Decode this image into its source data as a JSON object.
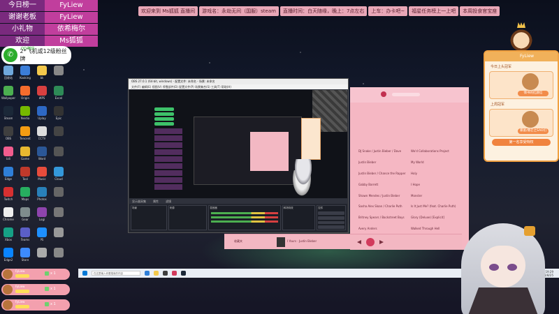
{
  "overlay_top_left": [
    {
      "key": "今日榜一",
      "value": "FyLiew"
    },
    {
      "key": "谢谢老板",
      "value": "FyLiew"
    },
    {
      "key": "小礼物",
      "value": "依希梅尔"
    },
    {
      "key": "欢迎",
      "value": "Ms狐狐"
    }
  ],
  "wechat": {
    "tag": "QQ/微信",
    "text": "2*飞机或12级粉丝牌"
  },
  "ticker": [
    "欢迎来到 Ms狐狐 直播间",
    "游戏名：永劫无间（国服）steam",
    "直播时间：白天随缘，晚上：7点左右",
    "上车：办卡吧~",
    "福星任务榜上一上吧",
    "本周投食官宝座"
  ],
  "desktop_icons": [
    {
      "label": "回收站",
      "color": "#6fa8dc"
    },
    {
      "label": "Kooking",
      "color": "#3b7dd8"
    },
    {
      "label": "bk",
      "color": "#f3c84b"
    },
    {
      "label": "",
      "color": "#888"
    },
    {
      "label": "Wallpaper",
      "color": "#4caf50"
    },
    {
      "label": "Origin",
      "color": "#f56c2d"
    },
    {
      "label": "WPS",
      "color": "#d94040"
    },
    {
      "label": "Excel",
      "color": "#2e8b57"
    },
    {
      "label": "Steam",
      "color": "#1b2838"
    },
    {
      "label": "Nvidia",
      "color": "#76b900"
    },
    {
      "label": "Uplay",
      "color": "#2d68c4"
    },
    {
      "label": "Epic",
      "color": "#333"
    },
    {
      "label": "OBS",
      "color": "#3f3f3f"
    },
    {
      "label": "Tencent",
      "color": "#f39c12"
    },
    {
      "label": "CCTV",
      "color": "#ddd"
    },
    {
      "label": "",
      "color": "#444"
    },
    {
      "label": "bili",
      "color": "#f25d8e"
    },
    {
      "label": "Game",
      "color": "#e8b830"
    },
    {
      "label": "Word",
      "color": "#2b5797"
    },
    {
      "label": "",
      "color": "#555"
    },
    {
      "label": "Edge",
      "color": "#2f7fd8"
    },
    {
      "label": "Tool",
      "color": "#c0392b"
    },
    {
      "label": "Music",
      "color": "#e74c3c"
    },
    {
      "label": "Cloud",
      "color": "#3498db"
    },
    {
      "label": "Twitch",
      "color": "#d63031"
    },
    {
      "label": "Maps",
      "color": "#27ae60"
    },
    {
      "label": "Photos",
      "color": "#2980b9"
    },
    {
      "label": "",
      "color": "#666"
    },
    {
      "label": "Chrome",
      "color": "#eee"
    },
    {
      "label": "Gear",
      "color": "#7f8c8d"
    },
    {
      "label": "Logi",
      "color": "#8e44ad"
    },
    {
      "label": "",
      "color": "#777"
    },
    {
      "label": "Xbox",
      "color": "#16a085"
    },
    {
      "label": "Teams",
      "color": "#5b5fc7"
    },
    {
      "label": "PS",
      "color": "#1e90ff"
    },
    {
      "label": "",
      "color": "#999"
    },
    {
      "label": "Edge2",
      "color": "#0a84ff"
    },
    {
      "label": "Store",
      "color": "#3d8bfd"
    },
    {
      "label": "",
      "color": "#aaa"
    },
    {
      "label": "",
      "color": "#888"
    }
  ],
  "obs": {
    "title": "OBS 27.0.1 (64-bit, windows) - 配置文件: 未命名 - 场景: 未命名",
    "menu": "文件(F)  编辑(E)  视图(V)  停靠部件(D)  配置文件(P)  场景集合(S)  工具(T)  帮助(H)",
    "toolbar": [
      "显示器采集",
      "属性",
      "滤镜"
    ],
    "docks": {
      "scenes": "场景",
      "sources": "来源",
      "mixer": "混音器",
      "transitions": "转场特效",
      "controls": "控件"
    },
    "controls": [
      "开始推流",
      "开始录制",
      "工作室模式",
      "设置",
      "退出"
    ]
  },
  "music": {
    "list": [
      {
        "artist": "DJ Snake / Justin Bieber / Dave",
        "song": "Wo'd Collaborations Project"
      },
      {
        "artist": "Justin Bieber",
        "song": "My World"
      },
      {
        "artist": "Justin Bieber / Chance the Rapper",
        "song": "Holy"
      },
      {
        "artist": "Gabby Barrett",
        "song": "I Hope"
      },
      {
        "artist": "Shawn Mendes / Justin Bieber",
        "song": "Monster"
      },
      {
        "artist": "Sasha Alex Sloan / Charlie Puth",
        "song": "Is It Just Me? (feat. Charlie Puth)"
      },
      {
        "artist": "Britney Spears / Backstreet Boys",
        "song": "Glory (Deluxe) [Explicit]"
      },
      {
        "artist": "Avery Anders",
        "song": "Walked Through Hell"
      }
    ],
    "bar_left": "收藏夹",
    "now_playing": "I Yours · Justin Bieber",
    "accent": "#d23a5c"
  },
  "right_panel": {
    "name": "FyLiew",
    "header": "FyLiew",
    "row1": "今日上头冠军",
    "row2": "上周冠军",
    "row3": "上周冠军",
    "pill1": "情书的红颜信",
    "pill2": "暴富/爆芒之SAO们",
    "button": "第一名享受特权"
  },
  "gifts": [
    {
      "name": "FyLiew",
      "count": "x 1"
    },
    {
      "name": "FyLiew",
      "count": "x 1"
    },
    {
      "name": "FyLiew",
      "count": "x 1"
    }
  ],
  "taskbar": {
    "search_placeholder": "在这里输入你要搜索的内容",
    "time": "19:29",
    "date": "2021/8/25"
  }
}
